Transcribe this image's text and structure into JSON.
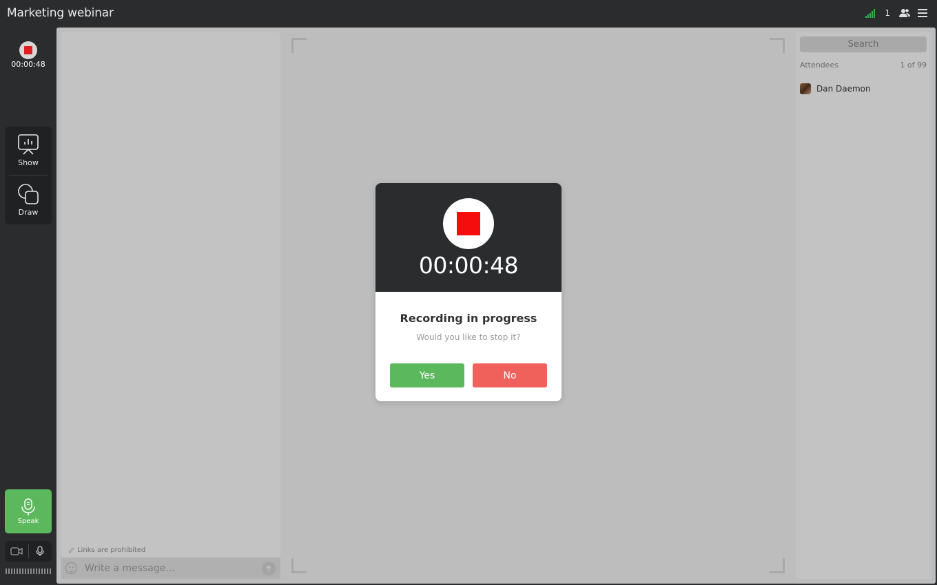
{
  "header": {
    "title": "Marketing webinar",
    "participant_count": "1",
    "signal_icon": "signal-bars-icon",
    "people_icon": "people-icon",
    "menu_icon": "hamburger-menu-icon"
  },
  "rail": {
    "recording_time": "00:00:48",
    "tools": [
      {
        "label": "Show",
        "icon": "presentation-icon"
      },
      {
        "label": "Draw",
        "icon": "shapes-icon"
      }
    ],
    "speak_label": "Speak"
  },
  "chat": {
    "links_note": "Links are prohibited",
    "placeholder": "Write a message..."
  },
  "attendees": {
    "search_placeholder": "Search",
    "header_label": "Attendees",
    "count_label": "1 of 99",
    "list": [
      {
        "name": "Dan Daemon"
      }
    ]
  },
  "modal": {
    "timer": "00:00:48",
    "title": "Recording in progress",
    "subtitle": "Would you like to stop it?",
    "yes_label": "Yes",
    "no_label": "No"
  },
  "colors": {
    "accent_green": "#5cb85c",
    "accent_red": "#f0615b",
    "record_red": "#f50d0d",
    "dark_bg": "#2b2c2e"
  }
}
